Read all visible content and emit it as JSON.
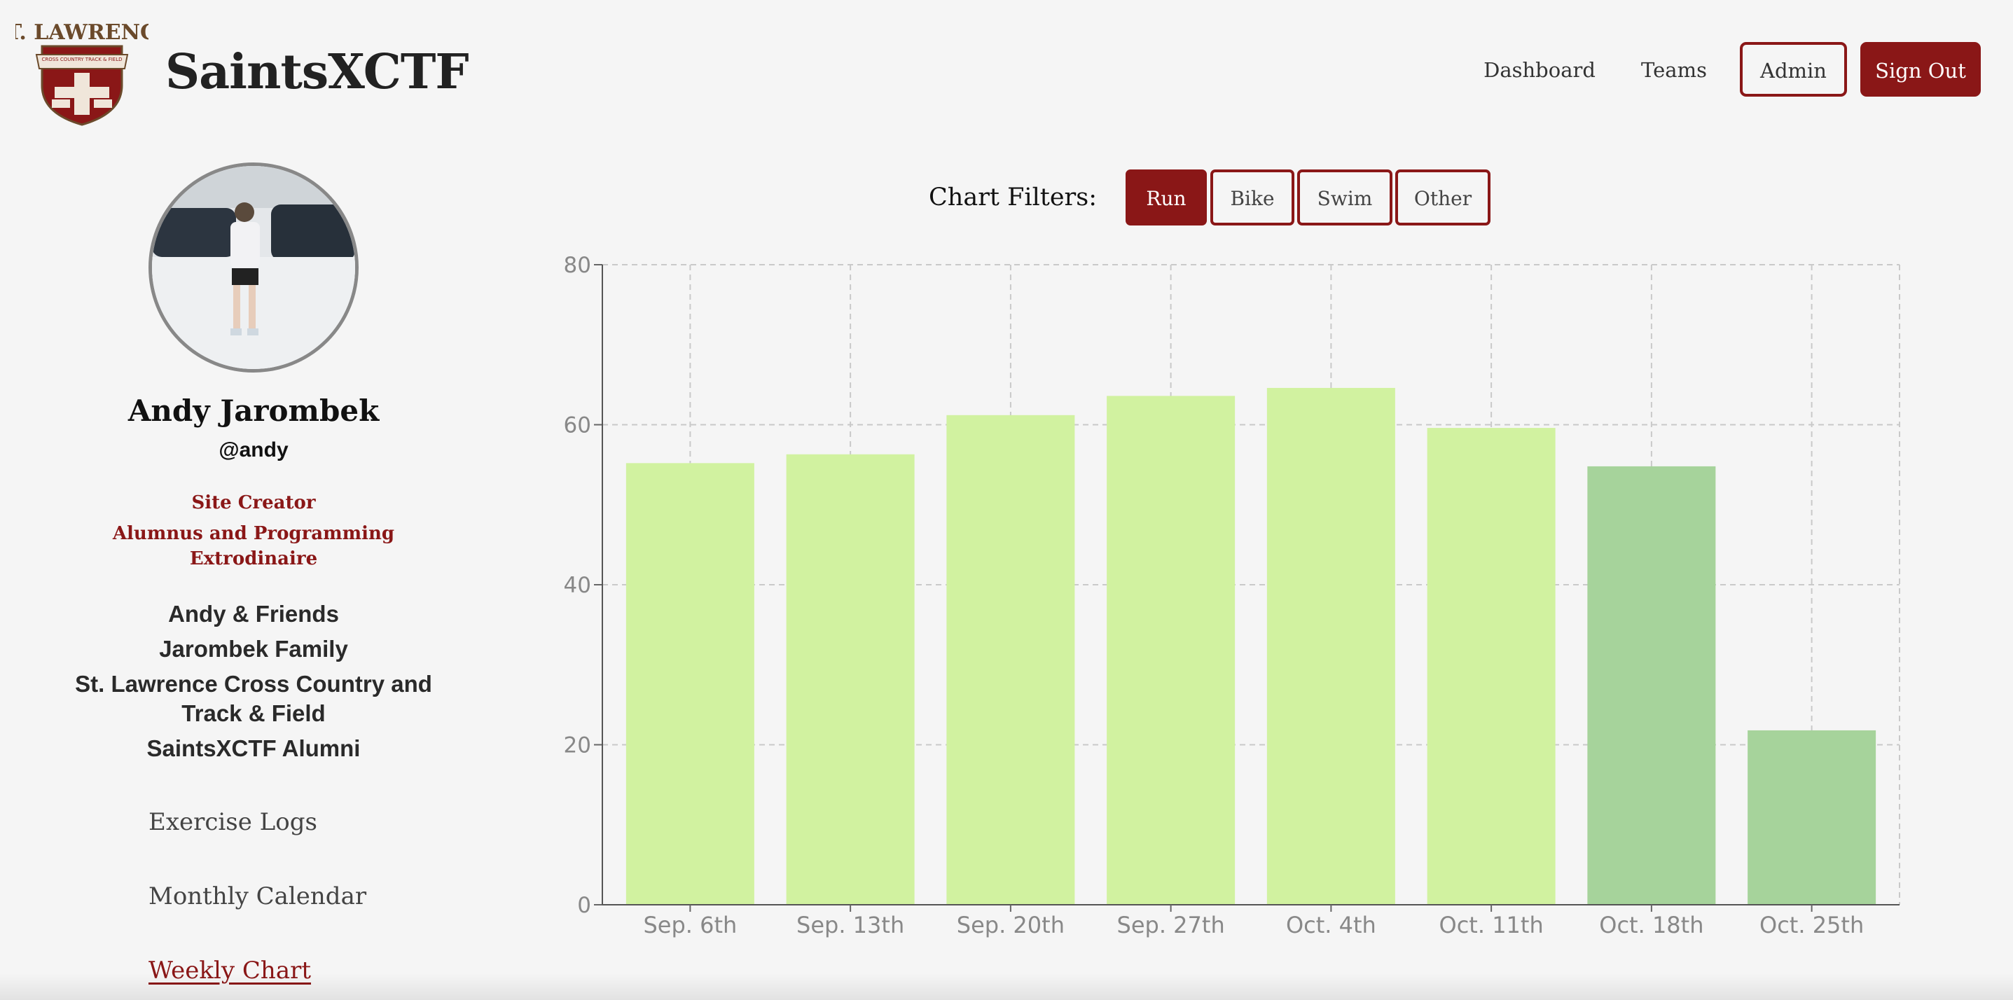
{
  "brand": {
    "title": "SaintsXCTF",
    "logo_text": "ST. LAWRENCE",
    "logo_subtext": "CROSS COUNTRY TRACK & FIELD"
  },
  "nav": {
    "dashboard": "Dashboard",
    "teams": "Teams",
    "admin": "Admin",
    "sign_out": "Sign Out"
  },
  "profile": {
    "name": "Andy Jarombek",
    "handle": "@andy",
    "roles": [
      "Site Creator",
      "Alumnus and Programming",
      "Extrodinaire"
    ],
    "groups": [
      "Andy & Friends",
      "Jarombek Family",
      "St. Lawrence Cross Country and",
      "Track & Field",
      "SaintsXCTF Alumni"
    ],
    "links": [
      "Exercise Logs",
      "Monthly Calendar",
      "Weekly Chart"
    ]
  },
  "filters": {
    "label": "Chart Filters:",
    "options": [
      "Run",
      "Bike",
      "Swim",
      "Other"
    ],
    "active": "Run"
  },
  "colors": {
    "brand_red": "#8a1717",
    "bar_light": "#d1f2a0",
    "bar_mid": "#a6d39b"
  },
  "chart_data": {
    "type": "bar",
    "categories": [
      "Sep. 6th",
      "Sep. 13th",
      "Sep. 20th",
      "Sep. 27th",
      "Oct. 4th",
      "Oct. 11th",
      "Oct. 18th",
      "Oct. 25th"
    ],
    "values": [
      55.2,
      56.3,
      61.2,
      63.6,
      64.6,
      59.6,
      54.8,
      21.8
    ],
    "bar_colors": [
      "#d1f2a0",
      "#d1f2a0",
      "#d1f2a0",
      "#d1f2a0",
      "#d1f2a0",
      "#d1f2a0",
      "#a6d39b",
      "#a6d39b"
    ],
    "yticks": [
      "0",
      "20",
      "40",
      "60",
      "80"
    ],
    "ylim": [
      0,
      80
    ],
    "grid": true,
    "xlabel": "",
    "ylabel": ""
  }
}
